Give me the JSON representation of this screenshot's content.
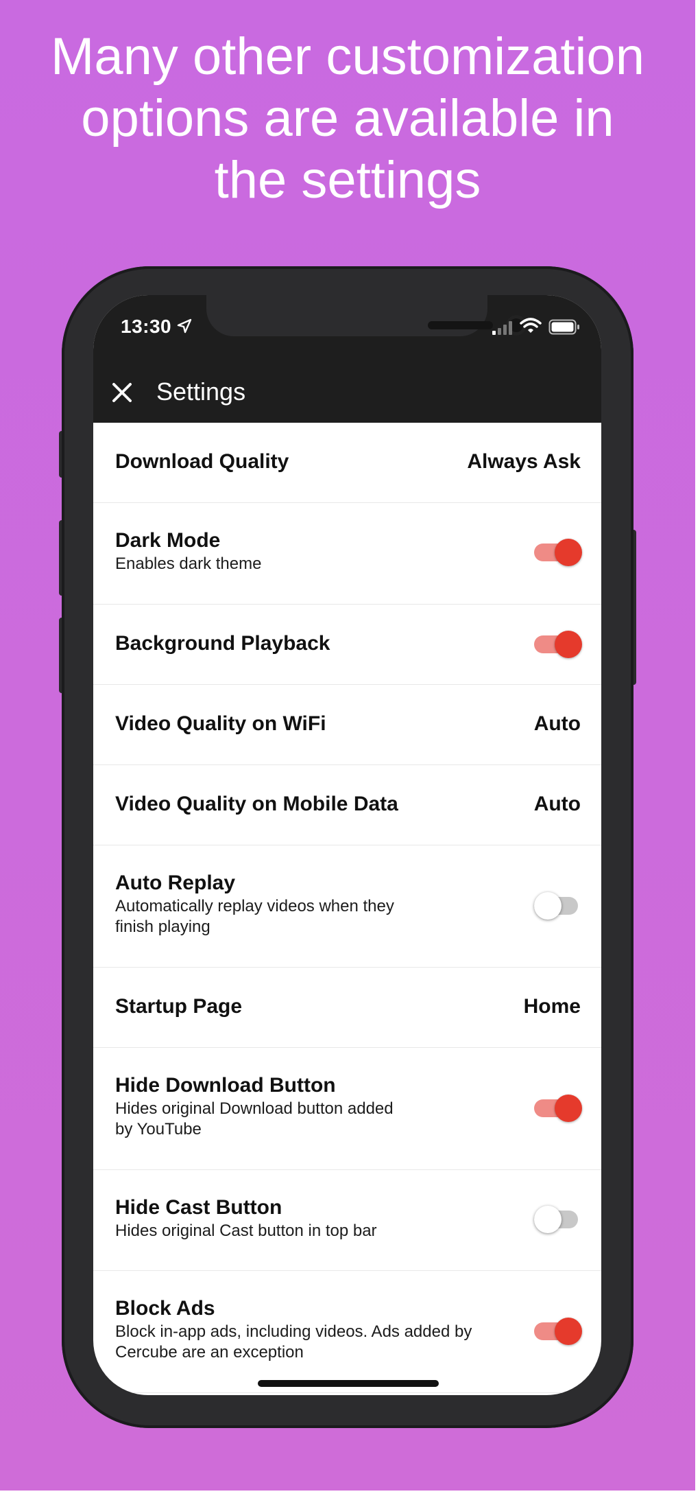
{
  "headline": "Many other customization\noptions are available in\nthe settings",
  "status_bar": {
    "time": "13:30",
    "icons": [
      "location-arrow-icon",
      "cellular-signal-icon",
      "wifi-icon",
      "battery-icon"
    ]
  },
  "app_bar": {
    "close_icon": "close-icon",
    "title": "Settings"
  },
  "colors": {
    "background": "#c96ae0",
    "app_bar": "#1e1e1e",
    "toggle_on_thumb": "#e53a2c",
    "toggle_on_track": "#ef8b86",
    "toggle_off_track": "#c8c8c8"
  },
  "settings": [
    {
      "title": "Download Quality",
      "value": "Always Ask"
    },
    {
      "title": "Dark Mode",
      "subtitle": "Enables dark theme",
      "toggle": true
    },
    {
      "title": "Background Playback",
      "toggle": true
    },
    {
      "title": "Video Quality on WiFi",
      "value": "Auto"
    },
    {
      "title": "Video Quality on Mobile Data",
      "value": "Auto"
    },
    {
      "title": "Auto Replay",
      "subtitle": "Automatically replay videos when they\nfinish playing",
      "toggle": false
    },
    {
      "title": "Startup Page",
      "value": "Home"
    },
    {
      "title": "Hide Download Button",
      "subtitle": "Hides original Download button added\nby YouTube",
      "toggle": true
    },
    {
      "title": "Hide Cast Button",
      "subtitle": "Hides original Cast button in top bar",
      "toggle": false
    },
    {
      "title": "Block Ads",
      "subtitle": "Block in-app ads, including videos. Ads added by\nCercube are an exception",
      "toggle": true
    }
  ]
}
